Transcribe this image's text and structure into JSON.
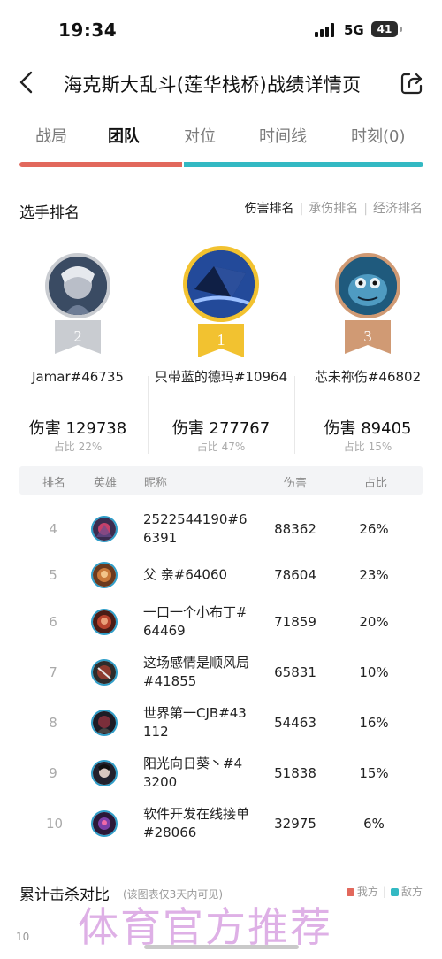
{
  "status_bar": {
    "time": "19:34",
    "network": "5G",
    "battery": "41"
  },
  "header": {
    "title": "海克斯大乱斗(莲华栈桥)战绩详情页"
  },
  "tabs": [
    {
      "label": "战局",
      "active": false
    },
    {
      "label": "团队",
      "active": true
    },
    {
      "label": "对位",
      "active": false
    },
    {
      "label": "时间线",
      "active": false
    },
    {
      "label": "时刻(0)",
      "active": false
    }
  ],
  "ranking": {
    "title": "选手排名",
    "sort_tabs": [
      "伤害排名",
      "承伤排名",
      "经济排名"
    ],
    "podium": [
      {
        "rank": "2",
        "name": "Jamar#46735",
        "damage": "伤害 129738",
        "share": "占比 22%"
      },
      {
        "rank": "1",
        "name": "只带蓝的德玛#10964",
        "damage": "伤害 277767",
        "share": "占比 47%"
      },
      {
        "rank": "3",
        "name": "芯未祢伤#46802",
        "damage": "伤害 89405",
        "share": "占比 15%"
      }
    ],
    "columns": {
      "rank": "排名",
      "hero": "英雄",
      "nickname": "昵称",
      "damage": "伤害",
      "share": "占比"
    },
    "rows": [
      {
        "rank": "4",
        "name": "2522544190#66391",
        "damage": "88362",
        "share": "26%"
      },
      {
        "rank": "5",
        "name": "父 亲#64060",
        "damage": "78604",
        "share": "23%"
      },
      {
        "rank": "6",
        "name": "一口一个小布丁#64469",
        "damage": "71859",
        "share": "20%"
      },
      {
        "rank": "7",
        "name": "这场感情是顺风局#41855",
        "damage": "65831",
        "share": "10%"
      },
      {
        "rank": "8",
        "name": "世界第一CJB#43112",
        "damage": "54463",
        "share": "16%"
      },
      {
        "rank": "9",
        "name": "阳光向日葵丶#43200",
        "damage": "51838",
        "share": "15%"
      },
      {
        "rank": "10",
        "name": "软件开发在线接单#28066",
        "damage": "32975",
        "share": "6%"
      }
    ]
  },
  "kill_chart": {
    "title": "累计击杀对比",
    "note": "(该图表仅3天内可见)",
    "legend": [
      "我方",
      "敌方"
    ],
    "y_tick": "10"
  },
  "watermark": "体育官方推荐",
  "colors": {
    "my_team": "#e2685c",
    "enemy_team": "#33b9c3",
    "gold": "#f2c230",
    "silver": "#c9ccd1",
    "bronze": "#d09a74"
  }
}
